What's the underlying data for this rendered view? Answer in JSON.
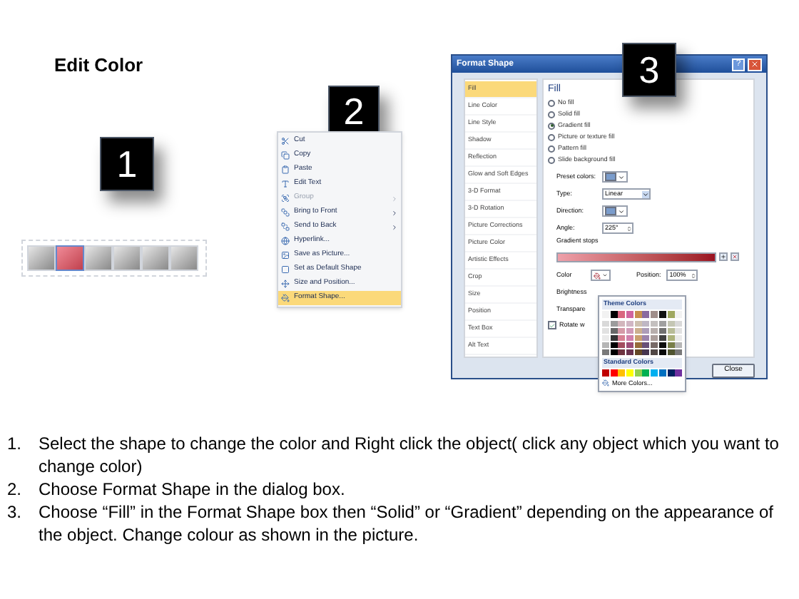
{
  "title": "Edit Color",
  "steps": [
    {
      "label": "1"
    },
    {
      "label": "2"
    },
    {
      "label": "3"
    }
  ],
  "shape_strip": {
    "segments": [
      {
        "selected": false
      },
      {
        "selected": true
      },
      {
        "selected": false
      },
      {
        "selected": false
      },
      {
        "selected": false
      },
      {
        "selected": false
      }
    ]
  },
  "context_menu": {
    "items": [
      {
        "label": "Cut",
        "disabled": false,
        "submenu": false,
        "selected": false
      },
      {
        "label": "Copy",
        "disabled": false,
        "submenu": false,
        "selected": false
      },
      {
        "label": "Paste",
        "disabled": false,
        "submenu": false,
        "selected": false
      },
      {
        "label": "Edit Text",
        "disabled": false,
        "submenu": false,
        "selected": false
      },
      {
        "label": "Group",
        "disabled": true,
        "submenu": true,
        "selected": false
      },
      {
        "label": "Bring to Front",
        "disabled": false,
        "submenu": true,
        "selected": false
      },
      {
        "label": "Send to Back",
        "disabled": false,
        "submenu": true,
        "selected": false
      },
      {
        "label": "Hyperlink...",
        "disabled": false,
        "submenu": false,
        "selected": false
      },
      {
        "label": "Save as Picture...",
        "disabled": false,
        "submenu": false,
        "selected": false
      },
      {
        "label": "Set as Default Shape",
        "disabled": false,
        "submenu": false,
        "selected": false
      },
      {
        "label": "Size and Position...",
        "disabled": false,
        "submenu": false,
        "selected": false
      },
      {
        "label": "Format Shape...",
        "disabled": false,
        "submenu": false,
        "selected": true
      }
    ]
  },
  "dialog": {
    "title": "Format Shape",
    "help": "?",
    "nav": [
      {
        "label": "Fill",
        "selected": true
      },
      {
        "label": "Line Color",
        "selected": false
      },
      {
        "label": "Line Style",
        "selected": false
      },
      {
        "label": "Shadow",
        "selected": false
      },
      {
        "label": "Reflection",
        "selected": false
      },
      {
        "label": "Glow and Soft Edges",
        "selected": false
      },
      {
        "label": "3-D Format",
        "selected": false
      },
      {
        "label": "3-D Rotation",
        "selected": false
      },
      {
        "label": "Picture Corrections",
        "selected": false
      },
      {
        "label": "Picture Color",
        "selected": false
      },
      {
        "label": "Artistic Effects",
        "selected": false
      },
      {
        "label": "Crop",
        "selected": false
      },
      {
        "label": "Size",
        "selected": false
      },
      {
        "label": "Position",
        "selected": false
      },
      {
        "label": "Text Box",
        "selected": false
      },
      {
        "label": "Alt Text",
        "selected": false
      }
    ],
    "heading": "Fill",
    "fill_options": [
      {
        "label": "No fill",
        "selected": false
      },
      {
        "label": "Solid fill",
        "selected": false
      },
      {
        "label": "Gradient fill",
        "selected": true
      },
      {
        "label": "Picture or texture fill",
        "selected": false
      },
      {
        "label": "Pattern fill",
        "selected": false
      },
      {
        "label": "Slide background fill",
        "selected": false
      }
    ],
    "preset_label": "Preset colors:",
    "type_label": "Type:",
    "type_value": "Linear",
    "direction_label": "Direction:",
    "angle_label": "Angle:",
    "angle_value": "225°",
    "stops_label": "Gradient stops",
    "color_label": "Color",
    "position_label": "Position:",
    "position_value": "100%",
    "brightness_label": "Brightness",
    "transparency_label": "Transpare",
    "rotate": {
      "label": "Rotate w",
      "checked": true
    },
    "close_button": "Close"
  },
  "color_picker": {
    "theme_title": "Theme Colors",
    "theme_colors": [
      {
        "color": "#f2f2f2"
      },
      {
        "color": "#000000"
      },
      {
        "color": "#d9667f"
      },
      {
        "color": "#d066a0"
      },
      {
        "color": "#c8904e"
      },
      {
        "color": "#8a6aa0"
      },
      {
        "color": "#a08e8a"
      },
      {
        "color": "#111111"
      },
      {
        "color": "#a0a860"
      },
      {
        "color": "#f2f2f2"
      }
    ],
    "standard_title": "Standard Colors",
    "standard_colors": [
      {
        "color": "#c00000"
      },
      {
        "color": "#ff0000"
      },
      {
        "color": "#ffc000"
      },
      {
        "color": "#ffff00"
      },
      {
        "color": "#92d050"
      },
      {
        "color": "#00b050"
      },
      {
        "color": "#00b0f0"
      },
      {
        "color": "#0070c0"
      },
      {
        "color": "#002060"
      },
      {
        "color": "#7030a0"
      }
    ],
    "more": "More Colors..."
  },
  "instructions": [
    {
      "number": "1.",
      "text": "Select the shape to change the color and Right click the object( click any object which you want to change color)"
    },
    {
      "number": "2.",
      "text": "Choose Format Shape in the dialog box."
    },
    {
      "number": "3.",
      "text": "Choose “Fill” in the Format Shape box then “Solid” or “Gradient” depending on the appearance of the object. Change colour as shown in the picture."
    }
  ]
}
